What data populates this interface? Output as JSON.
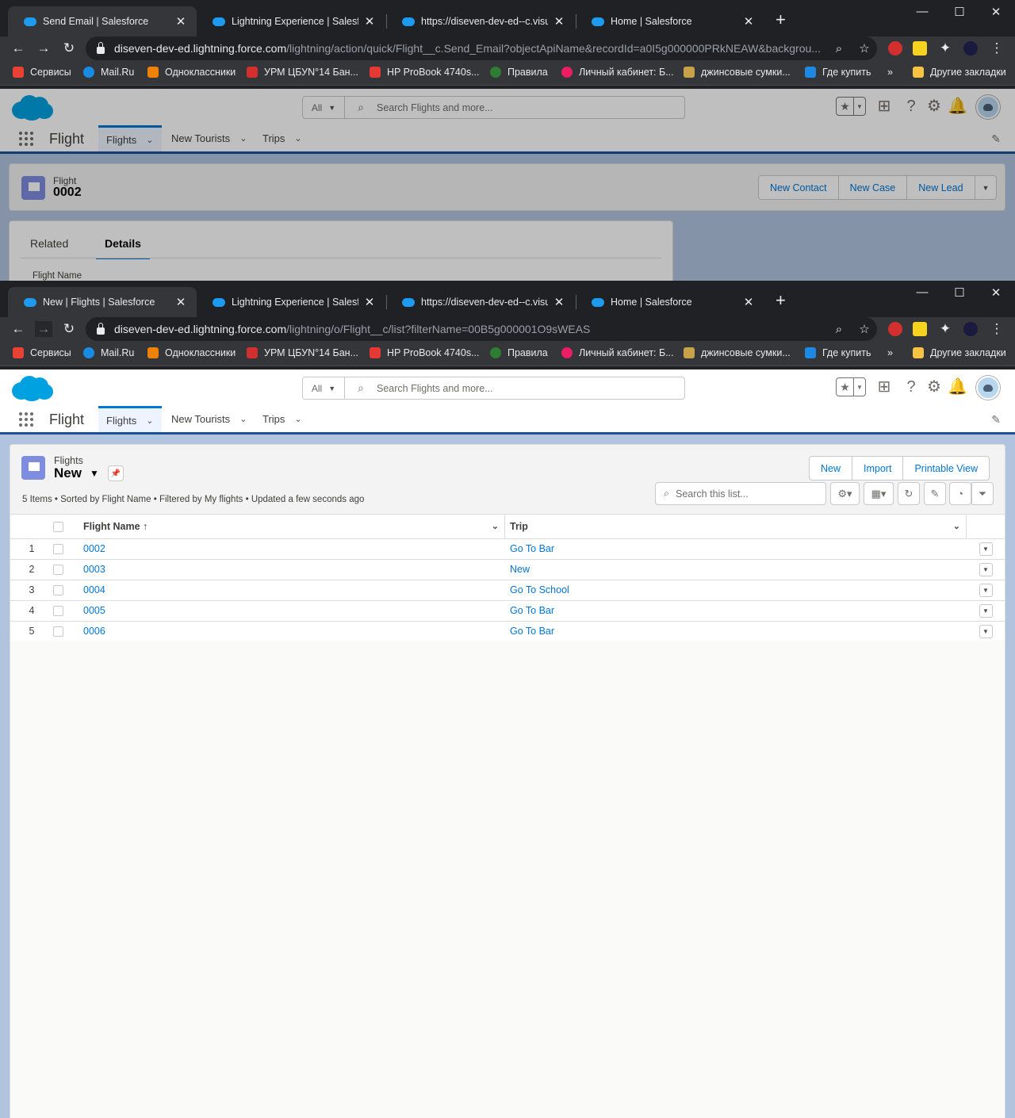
{
  "windows": [
    {
      "tabs": [
        {
          "title": "Send Email | Salesforce"
        },
        {
          "title": "Lightning Experience | Salesforce"
        },
        {
          "title": "https://diseven-dev-ed--c.visualf"
        },
        {
          "title": "Home | Salesforce"
        }
      ],
      "url_host": "diseven-dev-ed.lightning.force.com",
      "url_path": "/lightning/action/quick/Flight__c.Send_Email?objectApiName&recordId=a0I5g000000PRkNEAW&backgrou..."
    },
    {
      "tabs": [
        {
          "title": "New | Flights | Salesforce"
        },
        {
          "title": "Lightning Experience | Salesforce"
        },
        {
          "title": "https://diseven-dev-ed--c.visualf"
        },
        {
          "title": "Home | Salesforce"
        }
      ],
      "url_host": "diseven-dev-ed.lightning.force.com",
      "url_path": "/lightning/o/Flight__c/list?filterName=00B5g000001O9sWEAS"
    }
  ],
  "bookmarks": [
    {
      "label": "Сервисы",
      "color": "#e94235"
    },
    {
      "label": "Mail.Ru",
      "color": "#168de2"
    },
    {
      "label": "Одноклассники",
      "color": "#ee8208"
    },
    {
      "label": "УРМ ЦБУN°14 Бан...",
      "color": "#d32f2f"
    },
    {
      "label": "HP ProBook 4740s...",
      "color": "#e53935"
    },
    {
      "label": "Правила",
      "color": "#2e7d32"
    },
    {
      "label": "Личный кабинет: Б...",
      "color": "#e91e63"
    },
    {
      "label": "джинсовые сумки...",
      "color": "#c8a24a"
    },
    {
      "label": "Где купить",
      "color": "#1e88e5"
    },
    {
      "label": "»",
      "color": ""
    },
    {
      "label": "Другие закладки",
      "color": "#f6c343"
    }
  ],
  "salesforce": {
    "search_scope": "All",
    "search_placeholder": "Search Flights and more...",
    "app_name": "Flight",
    "nav": [
      {
        "label": "Flights"
      },
      {
        "label": "New Tourists"
      },
      {
        "label": "Trips"
      }
    ]
  },
  "record": {
    "object_label": "Flight",
    "name": "0002",
    "actions": [
      "New Contact",
      "New Case",
      "New Lead"
    ],
    "tabs": [
      "Related",
      "Details"
    ],
    "field_label": "Flight Name"
  },
  "list_view": {
    "object_label": "Flights",
    "view_name": "New",
    "meta": "5 Items • Sorted by Flight Name • Filtered by My flights • Updated a few seconds ago",
    "actions": [
      "New",
      "Import",
      "Printable View"
    ],
    "search_placeholder": "Search this list...",
    "columns": [
      "Flight Name",
      "Trip"
    ],
    "sort_indicator": "↑",
    "rows": [
      {
        "num": "1",
        "name": "0002",
        "trip": "Go To Bar"
      },
      {
        "num": "2",
        "name": "0003",
        "trip": "New"
      },
      {
        "num": "3",
        "name": "0004",
        "trip": "Go To School"
      },
      {
        "num": "4",
        "name": "0005",
        "trip": "Go To Bar"
      },
      {
        "num": "5",
        "name": "0006",
        "trip": "Go To Bar"
      }
    ]
  },
  "colors": {
    "brand": "#0176d3",
    "chrome_dark": "#202124",
    "chrome_toolbar": "#35363a",
    "nav_stripe": "#1b5297"
  }
}
